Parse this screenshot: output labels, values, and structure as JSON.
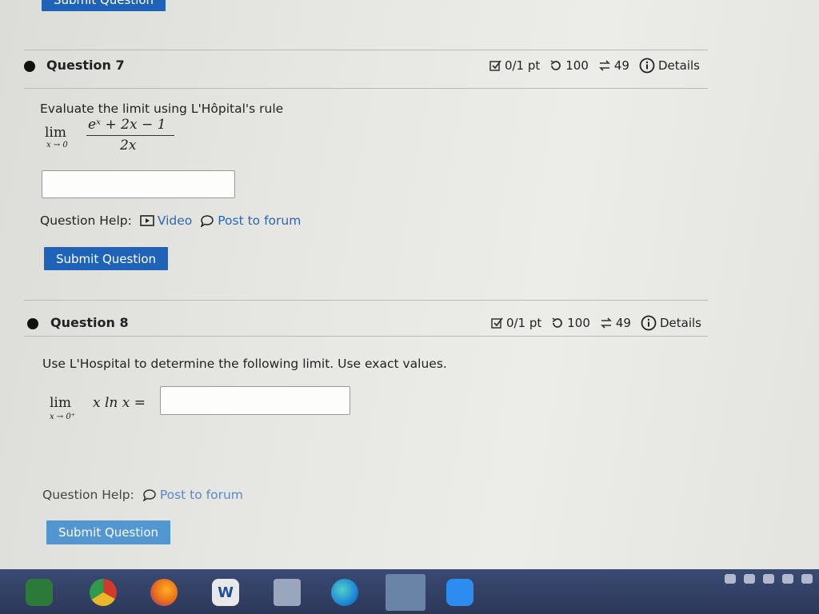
{
  "top": {
    "submit_label": "Submit Question"
  },
  "q7": {
    "title": "Question 7",
    "meta": {
      "score": "0/1 pt",
      "retries": "100",
      "attempts": "49",
      "details": "Details"
    },
    "prompt": "Evaluate the limit using L'Hôpital's rule",
    "math": {
      "lim": "lim",
      "sub": "x → 0",
      "numerator": "eˣ + 2x − 1",
      "denominator": "2x"
    },
    "answer_value": "",
    "help_label": "Question Help:",
    "video_label": "Video",
    "forum_label": "Post to forum",
    "submit_label": "Submit Question"
  },
  "q8": {
    "title": "Question 8",
    "meta": {
      "score": "0/1 pt",
      "retries": "100",
      "attempts": "49",
      "details": "Details"
    },
    "prompt": "Use L'Hospital to determine the following limit. Use exact values.",
    "math": {
      "lim": "lim",
      "sub": "x → 0⁺",
      "expr": "x ln x ="
    },
    "answer_value": "",
    "help_label": "Question Help:",
    "forum_label": "Post to forum",
    "submit_label": "Submit Question"
  },
  "taskbar": {
    "apps": [
      "windows-store",
      "chrome",
      "firefox",
      "word",
      "notes",
      "edge",
      "photos",
      "zoom"
    ],
    "word_letter": "W"
  },
  "colors": {
    "accent": "#1f63b8",
    "link": "#2b66b3",
    "taskbar": "#2c3859"
  }
}
